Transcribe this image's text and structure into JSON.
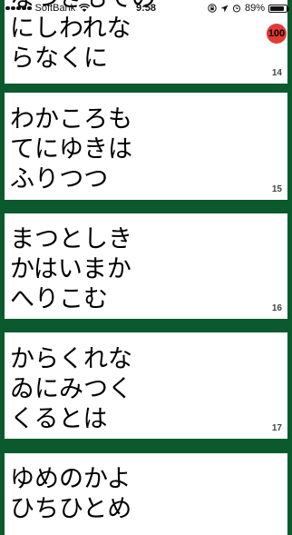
{
  "status_bar": {
    "carrier": "SoftBank",
    "time": "9:58",
    "battery_percent": "89%",
    "battery_level": 0.89,
    "icons": [
      "signal-icon",
      "wifi-icon",
      "lock-rotation-icon",
      "location-icon",
      "alarm-icon",
      "battery-icon"
    ]
  },
  "score_badge": "100",
  "cards": [
    {
      "lines": [
        "なつきもての",
        "にしわれな",
        "らなくに"
      ],
      "number": "14"
    },
    {
      "lines": [
        "わかころも",
        "てにゆきは",
        "ふりつつ"
      ],
      "number": "15"
    },
    {
      "lines": [
        "まつとしき",
        "かはいまか",
        "へりこむ"
      ],
      "number": "16"
    },
    {
      "lines": [
        "からくれな",
        "ゐにみつく",
        "くるとは"
      ],
      "number": "17"
    },
    {
      "lines": [
        "ゆめのかよ",
        "ひちひとめ",
        ""
      ],
      "number": ""
    }
  ],
  "colors": {
    "background": "#0b5a2e",
    "card": "#ffffff",
    "badge": "#e53935"
  }
}
